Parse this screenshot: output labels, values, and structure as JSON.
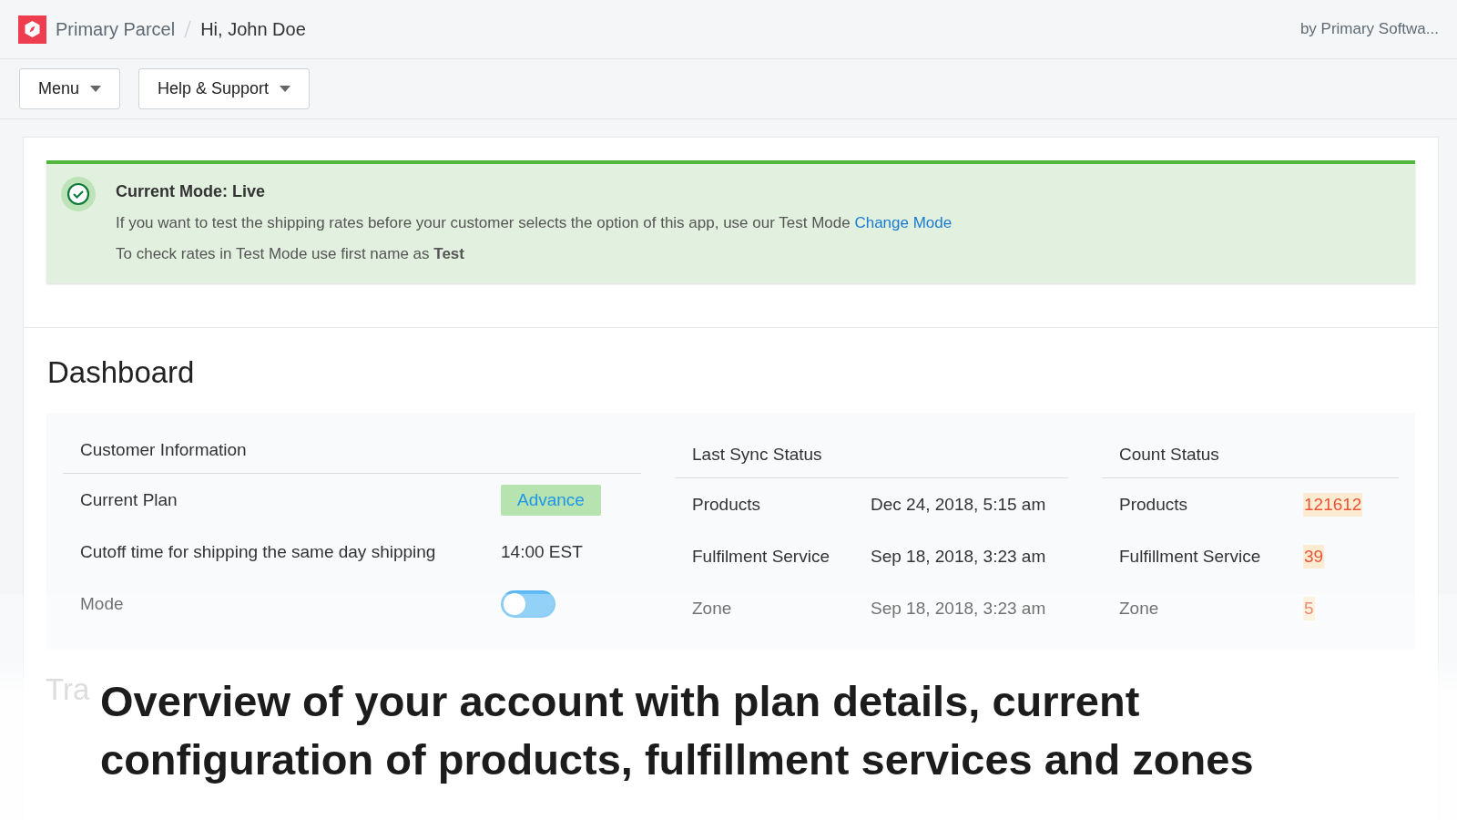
{
  "header": {
    "app_name": "Primary Parcel",
    "greeting": "Hi, John Doe",
    "vendor": "by Primary Softwa..."
  },
  "toolbar": {
    "buttons": [
      "Menu",
      "Help & Support"
    ]
  },
  "mode_banner": {
    "title": "Current Mode: Live",
    "message": "If you want to test the shipping rates before your customer selects the option of this app, use our Test Mode",
    "link": "Change Mode",
    "hint": "To check rates in Test Mode use first name as **Test**"
  },
  "dashboard": {
    "title": "Dashboard",
    "customer_information": {
      "heading": "Customer Information",
      "rows": [
        {
          "kind": "badge",
          "label": "Current Plan",
          "value": "Advance"
        },
        {
          "kind": "text",
          "label": "Cutoff time for shipping the same day shipping",
          "value": "14:00 EST"
        },
        {
          "kind": "toggle",
          "label": "Mode",
          "on": false
        }
      ]
    },
    "last_sync_status": {
      "heading": "Last Sync Status",
      "rows": [
        {
          "label": "Products",
          "value": "Dec 24, 2018, 5:15 am"
        },
        {
          "label": "Fulfilment Service",
          "value": "Sep 18, 2018, 3:23 am"
        },
        {
          "label": "Zone",
          "value": "Sep 18, 2018, 3:23 am"
        }
      ]
    },
    "count_status": {
      "heading": "Count Status",
      "rows": [
        {
          "label": "Products",
          "value": "121612"
        },
        {
          "label": "Fulfillment Service",
          "value": "39"
        },
        {
          "label": "Zone",
          "value": "5"
        }
      ]
    },
    "next_section_title": "Tra"
  },
  "caption": "Overview of your account with plan details, current configuration of products, fulfillment services and zones"
}
